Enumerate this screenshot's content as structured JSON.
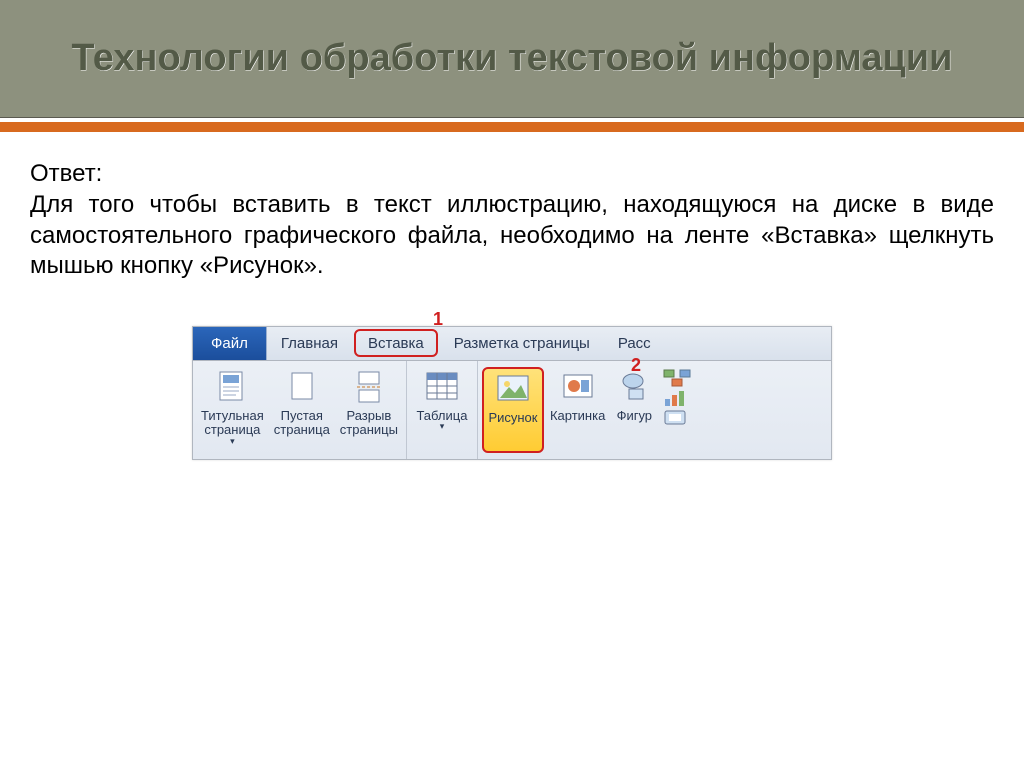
{
  "title": "Технологии обработки текстовой информации",
  "answer_label": "Ответ:",
  "answer_text": "Для того чтобы вставить в текст иллюстрацию, находящуюся на диске в виде самостоятельного графического файла, необходимо на ленте «Вставка» щелкнуть мышью кнопку «Рисунок».",
  "annotations": {
    "one": "1",
    "two": "2"
  },
  "tabs": {
    "file": "Файл",
    "home": "Главная",
    "insert": "Вставка",
    "layout": "Разметка страницы",
    "mailings": "Расс"
  },
  "buttons": {
    "cover_page": "Титульная\nстраница",
    "blank_page": "Пустая\nстраница",
    "page_break": "Разрыв\nстраницы",
    "table": "Таблица",
    "picture": "Рисунок",
    "clipart": "Картинка",
    "shapes": "Фигур"
  }
}
